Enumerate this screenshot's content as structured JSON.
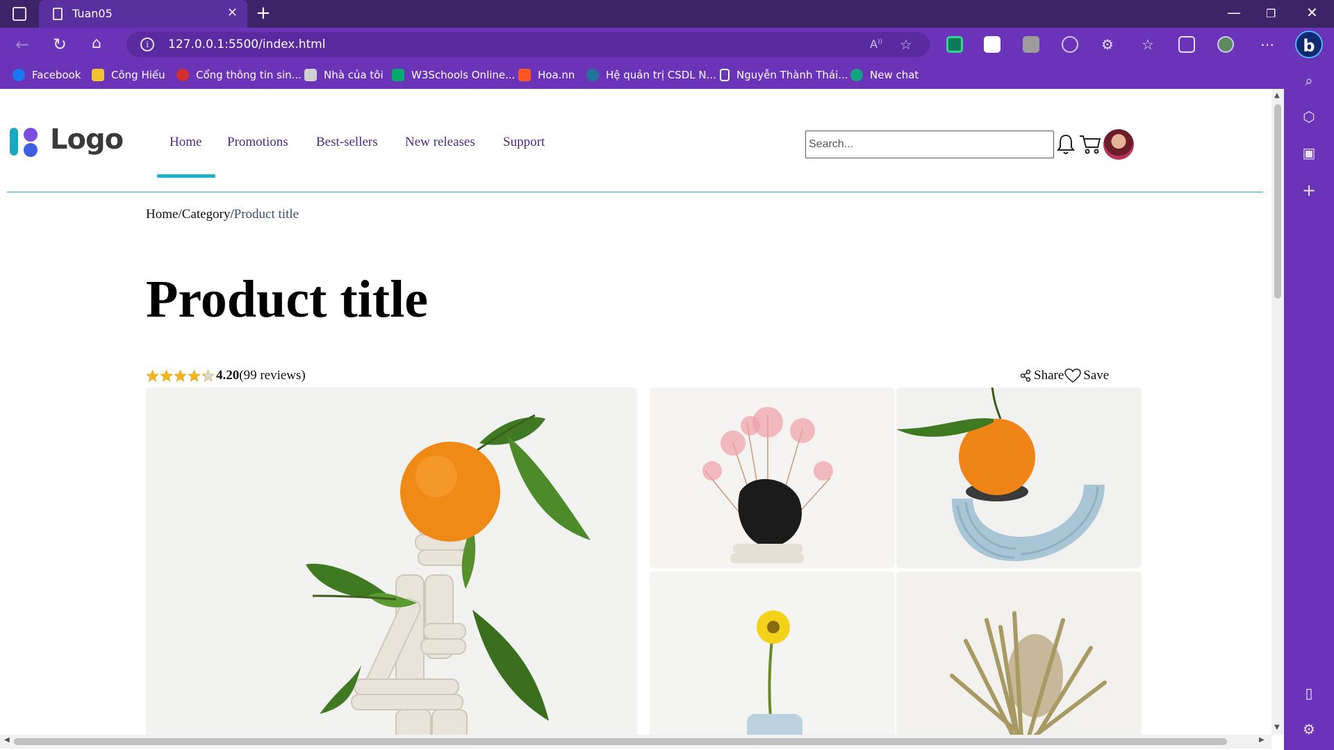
{
  "browser": {
    "tab_title": "Tuan05",
    "url": "127.0.0.1:5500/index.html",
    "read_aloud_label": "A̅",
    "bookmarks": [
      {
        "label": "Facebook",
        "icon": "facebook-icon",
        "color": "#1877f2"
      },
      {
        "label": "Công Hiếu",
        "icon": "folder-icon",
        "color": "#f4c430"
      },
      {
        "label": "Cổng thông tin sin...",
        "icon": "portal-icon",
        "color": "#d32f2f"
      },
      {
        "label": "Nhà của tôi",
        "icon": "home-page-icon",
        "color": "#cfcfcf"
      },
      {
        "label": "W3Schools Online...",
        "icon": "w3schools-icon",
        "color": "#04aa6d"
      },
      {
        "label": "Hoa.nn",
        "icon": "blogger-icon",
        "color": "#ff5722"
      },
      {
        "label": "Hệ quản trị CSDL N...",
        "icon": "wordpress-icon",
        "color": "#21759b"
      },
      {
        "label": "Nguyễn Thành Thái...",
        "icon": "document-icon",
        "color": "#ffffff"
      },
      {
        "label": "New chat",
        "icon": "chatgpt-icon",
        "color": "#10a37f"
      }
    ]
  },
  "site": {
    "logo_text": "Logo",
    "brand_colors": {
      "primary": "#4b2a8a",
      "accent": "#1ab3c9",
      "logo_teal": "#1aa9c0",
      "logo_purple": "#7a4fe0"
    },
    "nav": [
      "Home",
      "Promotions",
      "Best-sellers",
      "New releases",
      "Support"
    ],
    "active_nav": "Home",
    "search_placeholder": "Search..."
  },
  "breadcrumb": {
    "home": "Home",
    "sep1": "/",
    "category": "Category",
    "sep2": "/",
    "current": "Product title"
  },
  "product": {
    "title": "Product title",
    "rating_value": "4.20",
    "rating_stars": 4.2,
    "reviews_text": "(99 reviews)",
    "share_label": "Share",
    "save_label": "Save"
  },
  "gallery": [
    {
      "name": "main-image-orange-sculpture",
      "desc": "tangerine with leaves on white clay sculpture"
    },
    {
      "name": "thumb-pink-dried-flowers"
    },
    {
      "name": "thumb-orange-on-blue-vase"
    },
    {
      "name": "thumb-yellow-flower"
    },
    {
      "name": "thumb-dried-banksia"
    }
  ]
}
